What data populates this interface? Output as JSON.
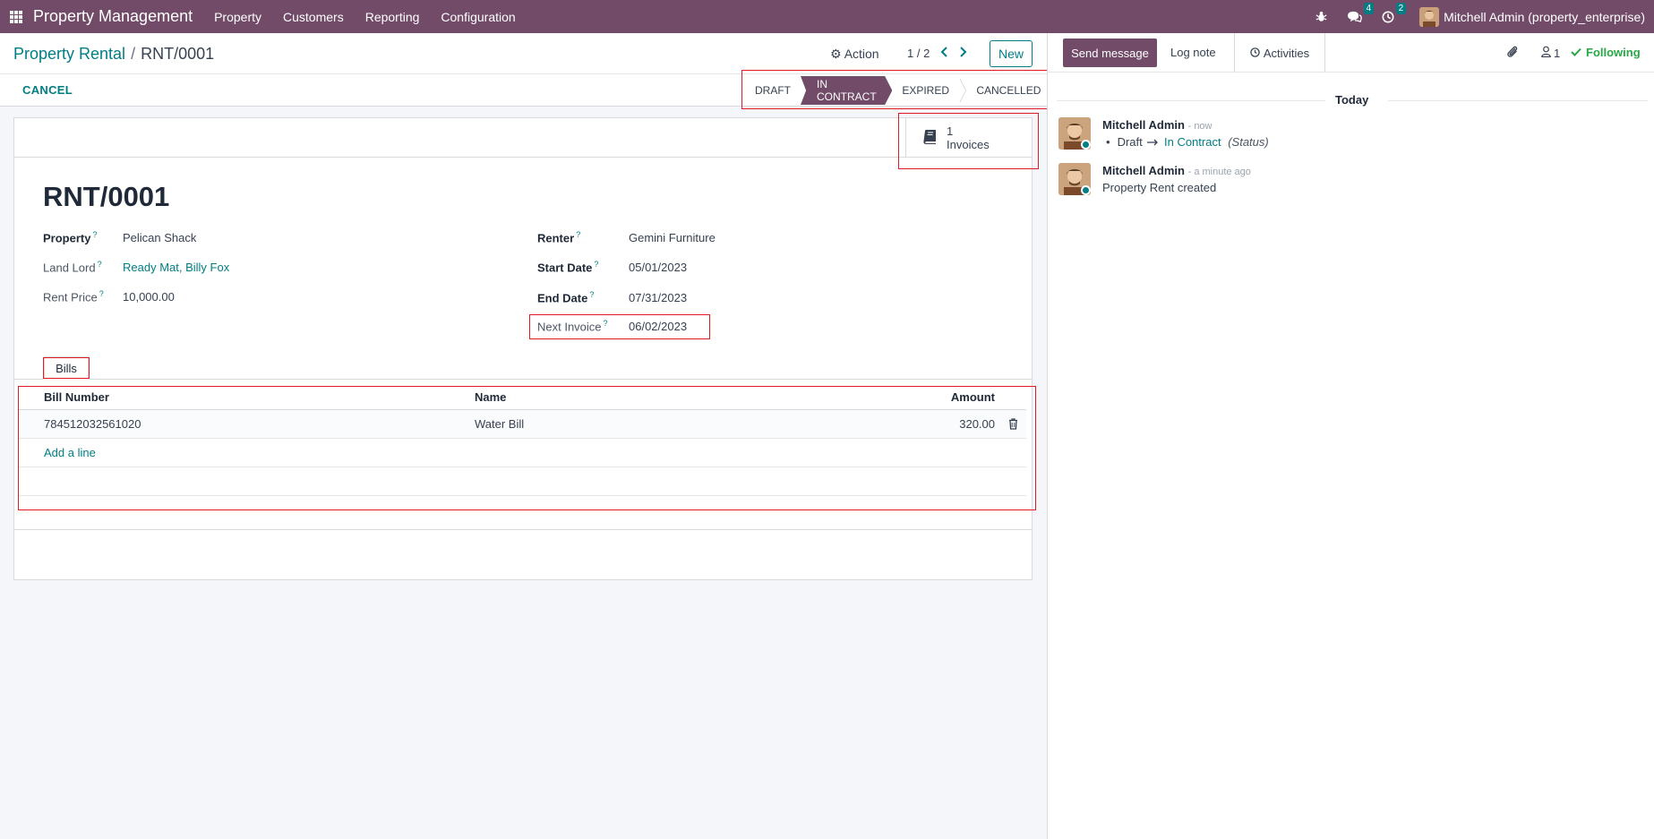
{
  "navbar": {
    "brand": "Property Management",
    "menu": [
      "Property",
      "Customers",
      "Reporting",
      "Configuration"
    ],
    "messages_badge": "4",
    "activities_badge": "2",
    "user_name": "Mitchell Admin (property_enterprise)"
  },
  "control": {
    "breadcrumb_parent": "Property Rental",
    "breadcrumb_sep": "/",
    "breadcrumb_current": "RNT/0001",
    "action_label": "Action",
    "pager": "1 / 2",
    "new_label": "New"
  },
  "statusbar": {
    "cancel_label": "CANCEL",
    "stages": [
      "DRAFT",
      "IN CONTRACT",
      "EXPIRED",
      "CANCELLED"
    ],
    "active_stage": "IN CONTRACT"
  },
  "smart_button": {
    "count": "1",
    "label": "Invoices"
  },
  "record": {
    "title": "RNT/0001",
    "fields_left": [
      {
        "label": "Property",
        "value": "Pelican Shack"
      },
      {
        "label": "Land Lord",
        "value": "Ready Mat, Billy Fox"
      },
      {
        "label": "Rent Price",
        "value": "10,000.00"
      }
    ],
    "fields_right": [
      {
        "label": "Renter",
        "value": "Gemini Furniture"
      },
      {
        "label": "Start Date",
        "value": "05/01/2023"
      },
      {
        "label": "End Date",
        "value": "07/31/2023"
      },
      {
        "label": "Next Invoice",
        "value": "06/02/2023"
      }
    ],
    "help_mark": "?"
  },
  "bills": {
    "tab_label": "Bills",
    "columns": [
      "Bill Number",
      "Name",
      "Amount"
    ],
    "rows": [
      {
        "bill_number": "784512032561020",
        "name": "Water Bill",
        "amount": "320.00"
      }
    ],
    "add_line": "Add a line"
  },
  "chatter": {
    "send_message": "Send message",
    "log_note": "Log note",
    "activities": "Activities",
    "followers": "1",
    "following": "Following",
    "today": "Today",
    "messages": [
      {
        "author": "Mitchell Admin",
        "time": "- now",
        "old_status": "Draft",
        "new_status": "In Contract",
        "field": "(Status)"
      },
      {
        "author": "Mitchell Admin",
        "time": "- a minute ago",
        "body": "Property Rent created"
      }
    ]
  },
  "colors": {
    "brand": "#714b67",
    "accent": "#017e84",
    "following": "#28a745",
    "highlight": "#e01b24"
  }
}
